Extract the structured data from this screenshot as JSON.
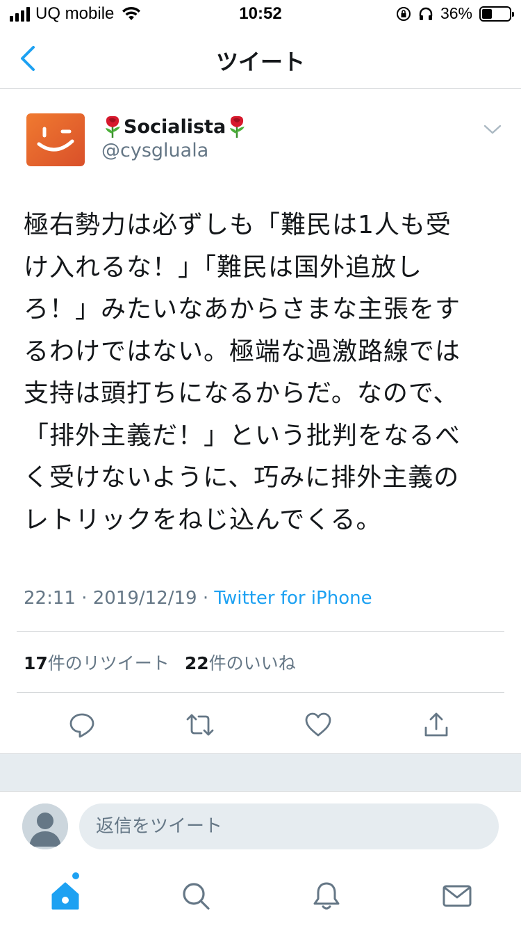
{
  "status_bar": {
    "carrier": "UQ mobile",
    "time": "10:52",
    "battery_percent": "36%",
    "battery_level": 0.36
  },
  "nav": {
    "title": "ツイート"
  },
  "tweet": {
    "display_name": "Socialista",
    "handle": "@cysgluala",
    "text_lines": [
      "極右勢力は必ずしも「難民は1人も受",
      "け入れるな！」「難民は国外追放し",
      "ろ！」みたいなあからさまな主張をす",
      "るわけではない。極端な過激路線では",
      "支持は頭打ちになるからだ。なので、",
      "「排外主義だ！」という批判をなるべ",
      "く受けないように、巧みに排外主義の",
      "レトリックをねじ込んでくる。"
    ],
    "time": "22:11",
    "date": "2019/12/19",
    "separator": "·",
    "client": "Twitter for iPhone",
    "retweet_count": "17",
    "retweet_label": "件のリツイート",
    "like_count": "22",
    "like_label": "件のいいね"
  },
  "reply": {
    "placeholder": "返信をツイート"
  },
  "icons": {
    "back": "chevron-left-icon",
    "more": "chevron-down-icon",
    "reply": "reply-icon",
    "retweet": "retweet-icon",
    "like": "heart-icon",
    "share": "share-icon",
    "home": "home-icon",
    "search": "search-icon",
    "notifications": "bell-icon",
    "messages": "envelope-icon"
  },
  "colors": {
    "accent": "#1da1f2",
    "text_primary": "#14171a",
    "text_secondary": "#657786",
    "avatar_orange": "#e8622e"
  }
}
